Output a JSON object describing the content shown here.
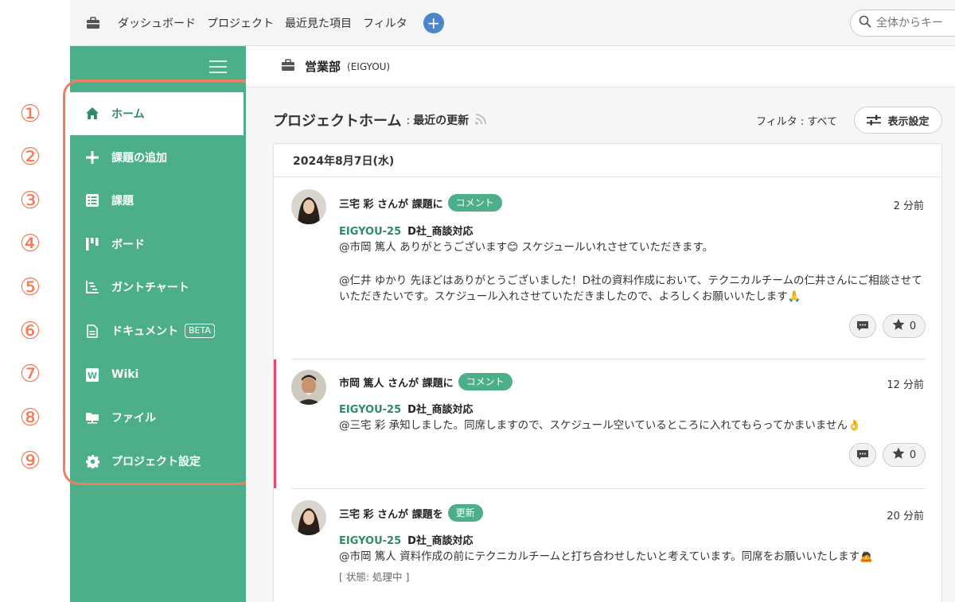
{
  "topnav": {
    "items": [
      "ダッシュボード",
      "プロジェクト",
      "最近見た項目",
      "フィルタ"
    ],
    "add_label": "+",
    "search_placeholder": "全体からキー"
  },
  "project": {
    "name": "営業部",
    "key": "(EIGYOU)"
  },
  "sidebar": {
    "items": [
      {
        "num": "①",
        "label": "ホーム",
        "icon": "home-icon",
        "active": true
      },
      {
        "num": "②",
        "label": "課題の追加",
        "icon": "plus-icon"
      },
      {
        "num": "③",
        "label": "課題",
        "icon": "list-icon"
      },
      {
        "num": "④",
        "label": "ボード",
        "icon": "board-icon"
      },
      {
        "num": "⑤",
        "label": "ガントチャート",
        "icon": "gantt-icon"
      },
      {
        "num": "⑥",
        "label": "ドキュメント",
        "icon": "document-icon",
        "badge": "BETA"
      },
      {
        "num": "⑦",
        "label": "Wiki",
        "icon": "wiki-icon"
      },
      {
        "num": "⑧",
        "label": "ファイル",
        "icon": "folder-icon"
      },
      {
        "num": "⑨",
        "label": "プロジェクト設定",
        "icon": "gear-icon"
      }
    ]
  },
  "home": {
    "title": "プロジェクトホーム",
    "colon": ":",
    "subtitle": "最近の更新",
    "filter_text": "フィルタ : すべて",
    "display_settings": "表示設定",
    "date": "2024年8月7日(水)"
  },
  "activity": [
    {
      "who": "三宅 彩 さんが 課題に",
      "tag": "コメント",
      "time": "2 分前",
      "issue_key": "EIGYOU-25",
      "issue_summary": "D社_商談対応",
      "line1": "@市岡 篤人 ありがとうございます😊 スケジュールいれさせていただきます。",
      "line2": "@仁井 ゆかり 先ほどはありがとうございました！D社の資料作成において、テクニカルチームの仁井さんにご相談させていただきたいです。スケジュール入れさせていただきましたので、よろしくお願いいたします🙏",
      "stars": "0"
    },
    {
      "who": "市岡 篤人 さんが 課題に",
      "tag": "コメント",
      "time": "12 分前",
      "issue_key": "EIGYOU-25",
      "issue_summary": "D社_商談対応",
      "line1": "@三宅 彩 承知しました。同席しますので、スケジュール空いているところに入れてもらってかまいません👌",
      "stars": "0"
    },
    {
      "who": "三宅 彩 さんが 課題を",
      "tag": "更新",
      "time": "20 分前",
      "issue_key": "EIGYOU-25",
      "issue_summary": "D社_商談対応",
      "line1": "@市岡 篤人 資料作成の前にテクニカルチームと打ち合わせしたいと考えています。同席をお願いいたします🙇",
      "status": "[ 状態: 処理中 ]"
    }
  ],
  "colors": {
    "sidebar": "#4caf8a",
    "accent": "#2e8b64",
    "highlight": "#f07f62",
    "mark": "#e54a6e"
  }
}
